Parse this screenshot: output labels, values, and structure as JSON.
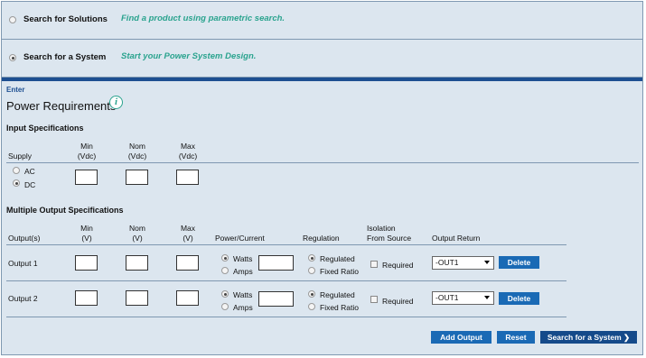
{
  "options": [
    {
      "label": "Search for Solutions",
      "desc": "Find a product using parametric search.",
      "selected": false
    },
    {
      "label": "Search for a System",
      "desc": "Start your Power System Design.",
      "selected": true
    }
  ],
  "enter_label": "Enter",
  "title": "Power Requirements",
  "info_icon": "i",
  "input_spec": {
    "heading": "Input Specifications",
    "supply_label": "Supply",
    "min_label": "Min",
    "nom_label": "Nom",
    "max_label": "Max",
    "unit": "(Vdc)",
    "supply_options": [
      {
        "label": "AC",
        "selected": false
      },
      {
        "label": "DC",
        "selected": true
      }
    ]
  },
  "output_spec": {
    "heading": "Multiple Output Specifications",
    "outputs_label": "Output(s)",
    "min_label": "Min",
    "nom_label": "Nom",
    "max_label": "Max",
    "unit": "(V)",
    "power_current_label": "Power/Current",
    "regulation_label": "Regulation",
    "isolation_label1": "Isolation",
    "isolation_label2": "From Source",
    "return_label": "Output Return",
    "rows": [
      {
        "name": "Output  1",
        "watts": "Watts",
        "amps": "Amps",
        "regulated": "Regulated",
        "fixed": "Fixed Ratio",
        "required": "Required",
        "return": "-OUT1",
        "delete": "Delete"
      },
      {
        "name": "Output  2",
        "watts": "Watts",
        "amps": "Amps",
        "regulated": "Regulated",
        "fixed": "Fixed Ratio",
        "required": "Required",
        "return": "-OUT1",
        "delete": "Delete"
      }
    ]
  },
  "buttons": {
    "add": "Add Output",
    "reset": "Reset",
    "search": "Search for a System ❯"
  }
}
